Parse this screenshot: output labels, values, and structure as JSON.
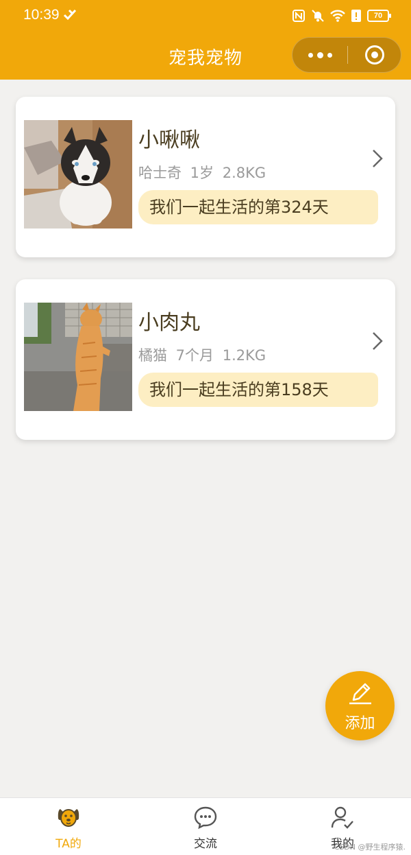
{
  "status_bar": {
    "time": "10:39",
    "battery": "70"
  },
  "header": {
    "title": "宠我宠物",
    "more_icon": "more-dots-icon",
    "close_icon": "target-circle-icon"
  },
  "pets": [
    {
      "name": "小啾啾",
      "meta": "哈士奇 1岁 2.8KG",
      "days": "我们一起生活的第324天",
      "photo_icon": "husky-photo"
    },
    {
      "name": "小肉丸",
      "meta": "橘猫 7个月 1.2KG",
      "days": "我们一起生活的第158天",
      "photo_icon": "orange-cat-photo"
    }
  ],
  "fab": {
    "label": "添加",
    "icon": "pencil-icon"
  },
  "tabbar": {
    "items": [
      {
        "label": "TA的",
        "icon": "dog-face-icon",
        "active": true
      },
      {
        "label": "交流",
        "icon": "chat-bubble-icon",
        "active": false
      },
      {
        "label": "我的",
        "icon": "user-check-icon",
        "active": false
      }
    ]
  },
  "watermark": "CSDN @野生程序猿.",
  "colors": {
    "accent": "#f1a80a",
    "capsule": "#c2860a",
    "days_bg": "#fdeec3",
    "background": "#f2f1ef"
  }
}
